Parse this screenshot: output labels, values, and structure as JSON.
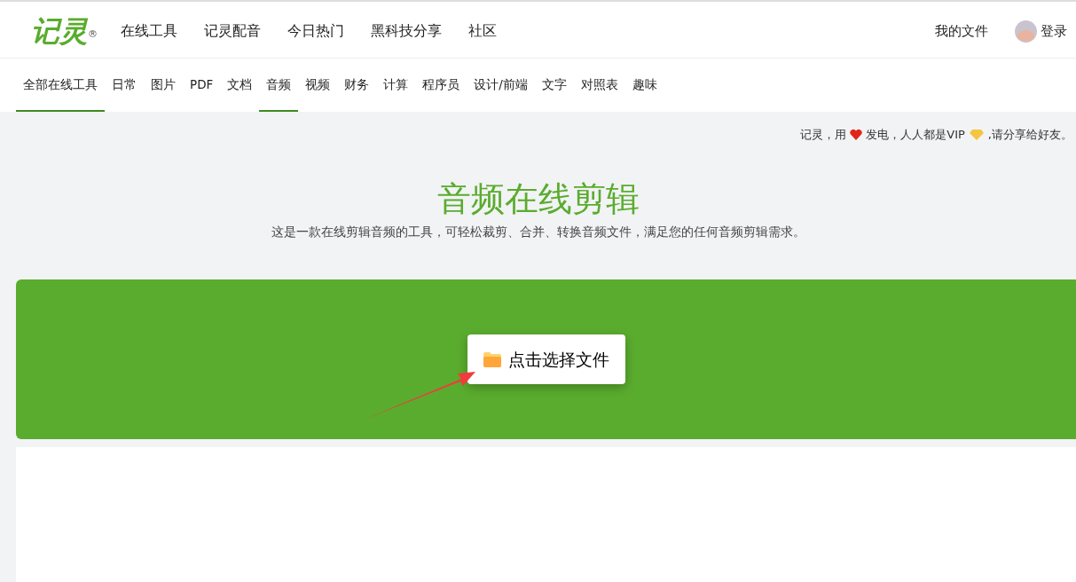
{
  "logo": {
    "text": "记灵",
    "mark": "®"
  },
  "nav": [
    {
      "label": "在线工具"
    },
    {
      "label": "记灵配音"
    },
    {
      "label": "今日热门"
    },
    {
      "label": "黑科技分享"
    },
    {
      "label": "社区"
    }
  ],
  "user_nav": {
    "files": "我的文件",
    "login": "登录"
  },
  "categories": [
    {
      "label": "全部在线工具",
      "selected": true
    },
    {
      "label": "日常",
      "selected": false
    },
    {
      "label": "图片",
      "selected": false
    },
    {
      "label": "PDF",
      "selected": false
    },
    {
      "label": "文档",
      "selected": false
    },
    {
      "label": "音频",
      "selected": true
    },
    {
      "label": "视频",
      "selected": false
    },
    {
      "label": "财务",
      "selected": false
    },
    {
      "label": "计算",
      "selected": false
    },
    {
      "label": "程序员",
      "selected": false
    },
    {
      "label": "设计/前端",
      "selected": false
    },
    {
      "label": "文字",
      "selected": false
    },
    {
      "label": "对照表",
      "selected": false
    },
    {
      "label": "趣味",
      "selected": false
    }
  ],
  "notice": {
    "before": "记灵，用",
    "middle": "发电，人人都是VIP",
    "after": ",请分享给好友。"
  },
  "hero": {
    "title": "音频在线剪辑",
    "subtitle": "这是一款在线剪辑音频的工具，可轻松裁剪、合并、转换音频文件，满足您的任何音频剪辑需求。"
  },
  "upload": {
    "button": "点击选择文件"
  }
}
